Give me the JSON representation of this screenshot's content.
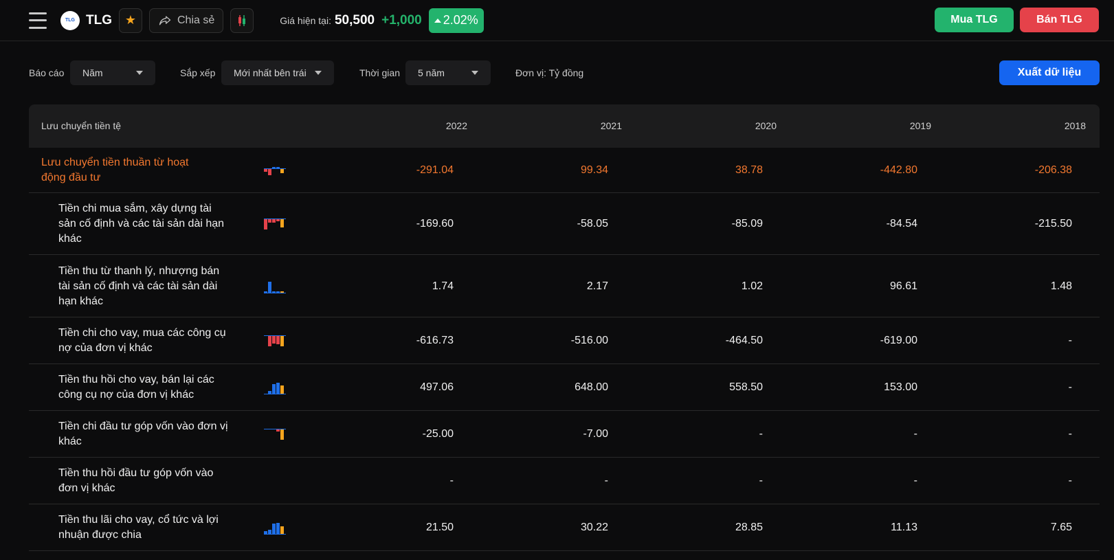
{
  "header": {
    "logo_text": "TLG",
    "ticker": "TLG",
    "share_label": "Chia sẻ",
    "price_label": "Giá hiện tại:",
    "price": "50,500",
    "change": "+1,000",
    "change_pct": "2.02%",
    "buy_label": "Mua TLG",
    "sell_label": "Bán TLG",
    "colors": {
      "up": "#23b36d",
      "down": "#e5424a",
      "accent": "#1565f0",
      "highlight": "#f3782f"
    }
  },
  "filters": {
    "report_label": "Báo cáo",
    "report_value": "Năm",
    "sort_label": "Sắp xếp",
    "sort_value": "Mới nhất bên trái",
    "time_label": "Thời gian",
    "time_value": "5 năm",
    "unit": "Đơn vị: Tỷ đồng",
    "export_label": "Xuất dữ liệu"
  },
  "table": {
    "header": "Lưu chuyển tiền tệ",
    "years": [
      "2022",
      "2021",
      "2020",
      "2019",
      "2018"
    ],
    "rows": [
      {
        "name": "Lưu chuyển tiền thuần từ hoạt động đầu tư",
        "values": [
          "-291.04",
          "99.34",
          "38.78",
          "-442.80",
          "-206.38"
        ],
        "main": true
      },
      {
        "name": "Tiền chi mua sắm, xây dựng tài sản cố định và các tài sản dài hạn khác",
        "values": [
          "-169.60",
          "-58.05",
          "-85.09",
          "-84.54",
          "-215.50"
        ]
      },
      {
        "name": "Tiền thu từ thanh lý, nhượng bán tài sản cố định và các tài sản dài hạn khác",
        "values": [
          "1.74",
          "2.17",
          "1.02",
          "96.61",
          "1.48"
        ]
      },
      {
        "name": "Tiền chi cho vay, mua các công cụ nợ của đơn vị khác",
        "values": [
          "-616.73",
          "-516.00",
          "-464.50",
          "-619.00",
          "-"
        ]
      },
      {
        "name": "Tiền thu hồi cho vay, bán lại các công cụ nợ của đơn vị khác",
        "values": [
          "497.06",
          "648.00",
          "558.50",
          "153.00",
          "-"
        ]
      },
      {
        "name": "Tiền chi đầu tư góp vốn vào đơn vị khác",
        "values": [
          "-25.00",
          "-7.00",
          "-",
          "-",
          "-"
        ]
      },
      {
        "name": "Tiền thu hồi đầu tư góp vốn vào đơn vị khác",
        "values": [
          "-",
          "-",
          "-",
          "-",
          "-"
        ]
      },
      {
        "name": "Tiền thu lãi cho vay, cổ tức và lợi nhuận được chia",
        "values": [
          "21.50",
          "30.22",
          "28.85",
          "11.13",
          "7.65"
        ]
      }
    ]
  }
}
